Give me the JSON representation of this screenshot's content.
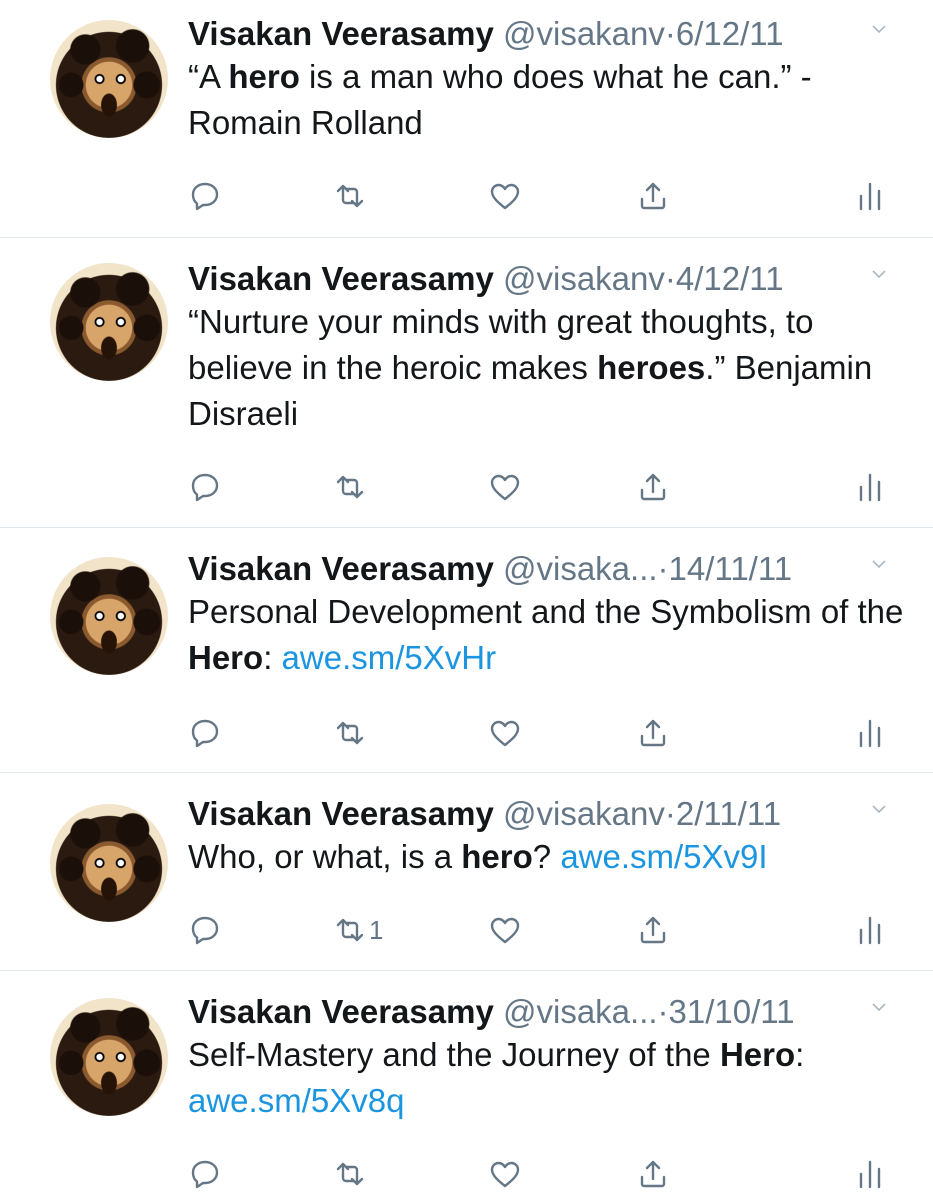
{
  "tweets": [
    {
      "name": "Visakan Veerasamy",
      "handle": "@visakanv",
      "date": "6/12/11",
      "text_parts": [
        "“A ",
        "hero",
        " is a man who does what he can.” - Romain Rolland"
      ],
      "retweet_count": ""
    },
    {
      "name": "Visakan Veerasamy",
      "handle": "@visakanv",
      "date": "4/12/11",
      "text_parts": [
        "“Nurture your minds with great thoughts, to believe in the heroic makes ",
        "heroes",
        ".” Benjamin Disraeli"
      ],
      "retweet_count": ""
    },
    {
      "name": "Visakan Veerasamy",
      "handle": "@visaka...",
      "date": "14/11/11",
      "text_parts": [
        "Personal Development and the Symbolism of the ",
        "Hero",
        ": "
      ],
      "link": "awe.sm/5XvHr",
      "retweet_count": ""
    },
    {
      "name": "Visakan Veerasamy",
      "handle": "@visakanv",
      "date": "2/11/11",
      "text_parts": [
        "Who, or what, is a ",
        "hero",
        "? "
      ],
      "link": "awe.sm/5Xv9I",
      "retweet_count": "1"
    },
    {
      "name": "Visakan Veerasamy",
      "handle": "@visaka...",
      "date": "31/10/11",
      "text_parts": [
        "Self-Mastery and the Journey of the ",
        "Hero",
        ":"
      ],
      "link": "awe.sm/5Xv8q",
      "retweet_count": ""
    }
  ],
  "separator": "·",
  "icons": [
    "reply-icon",
    "retweet-icon",
    "like-icon",
    "share-icon",
    "analytics-icon",
    "chevron-down-icon"
  ],
  "colors": {
    "text": "#14171a",
    "meta": "#657786",
    "link": "#1b95e0",
    "divider": "#e1e8ed"
  }
}
